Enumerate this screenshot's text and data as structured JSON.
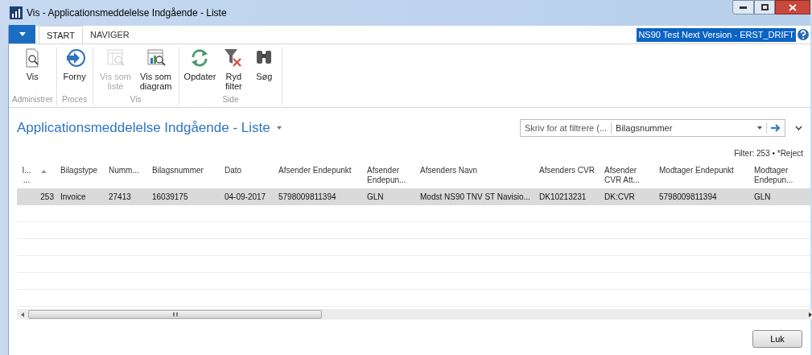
{
  "window": {
    "title": "Vis - Applicationsmeddelelse Indgående - Liste"
  },
  "ribbon_tabs": [
    {
      "label": "START",
      "selected": true
    },
    {
      "label": "NAVIGER",
      "selected": false
    }
  ],
  "company": "NS90 Test Next Version - ERST_DRIFT",
  "ribbon_groups": [
    {
      "label": "Administrer",
      "actions": [
        {
          "label": "Vis",
          "disabled": false
        }
      ]
    },
    {
      "label": "Proces",
      "actions": [
        {
          "label": "Forny",
          "disabled": false
        }
      ]
    },
    {
      "label": "Vis",
      "actions": [
        {
          "label": "Vis som liste",
          "disabled": true
        },
        {
          "label": "Vis som diagram",
          "disabled": false
        }
      ]
    },
    {
      "label": "Side",
      "actions": [
        {
          "label": "Opdater",
          "disabled": false
        },
        {
          "label": "Ryd filter",
          "disabled": false
        },
        {
          "label": "Søg",
          "disabled": false
        }
      ]
    }
  ],
  "page_title": "Applicationsmeddelelse Indgående - Liste",
  "filter": {
    "placeholder": "Skriv for at filtrere (...",
    "field": "Bilagsnummer",
    "summary": "Filter: 253 • *Reject"
  },
  "table": {
    "columns": [
      "I... ...",
      "Bilagstype",
      "Numm...",
      "Bilagsnummer",
      "Dato",
      "Afsender Endepunkt",
      "Afsender Endepun...",
      "Afsenders Navn",
      "Afsenders CVR",
      "Afsender CVR Att...",
      "Modtager Endepunkt",
      "Modtager Endepun..."
    ],
    "rows": [
      {
        "selected": true,
        "cells": [
          "253",
          "Invoice",
          "27413",
          "16039175",
          "04-09-2017",
          "5798009811394",
          "GLN",
          "Modst NS90 TNV ST Navisio...",
          "DK10213231",
          "DK:CVR",
          "5798009811394",
          "GLN"
        ]
      }
    ]
  },
  "buttons": [
    "Luk"
  ]
}
